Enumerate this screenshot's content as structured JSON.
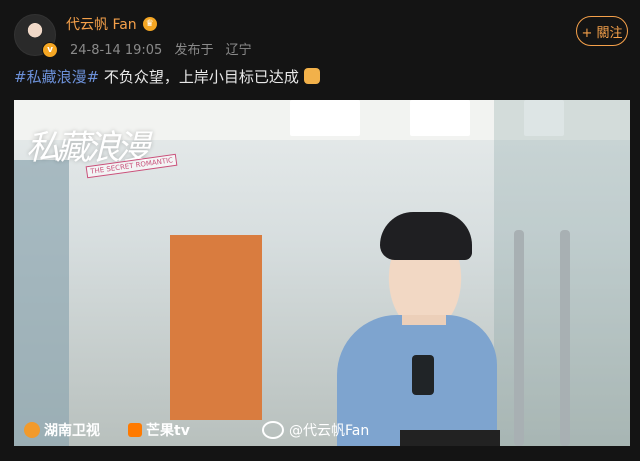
{
  "post": {
    "username": "代云帆 Fan",
    "crown_icon": "crown-badge-icon",
    "verified_icon": "v-verified-icon",
    "date": "24-8-14 19:05",
    "location_prefix": "发布于",
    "location": "辽宁",
    "follow_label": "+ 關注",
    "hashtag": "#私藏浪漫#",
    "text": " 不负众望，上岸小目标已达成",
    "emoji_icon": "thumbs-up-emoji"
  },
  "image": {
    "show_title": "私藏浪漫",
    "show_subtitle": "THE SECRET ROMANTIC",
    "logo_hunan": "湖南卫视",
    "logo_mango": "芒果tv",
    "watermark": "@代云帆Fan"
  },
  "colors": {
    "accent": "#f5a04a",
    "hashtag": "#6b8fd6",
    "background": "#141414"
  }
}
